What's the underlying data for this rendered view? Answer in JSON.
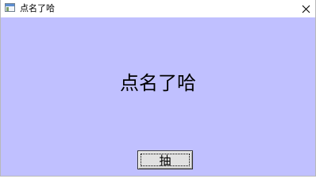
{
  "window": {
    "title": "点名了哈",
    "app_icon": "window-app-icon",
    "close_icon": "close-icon"
  },
  "main": {
    "heading": "点名了哈",
    "background": "#c0c0ff"
  },
  "button": {
    "label": "抽"
  }
}
